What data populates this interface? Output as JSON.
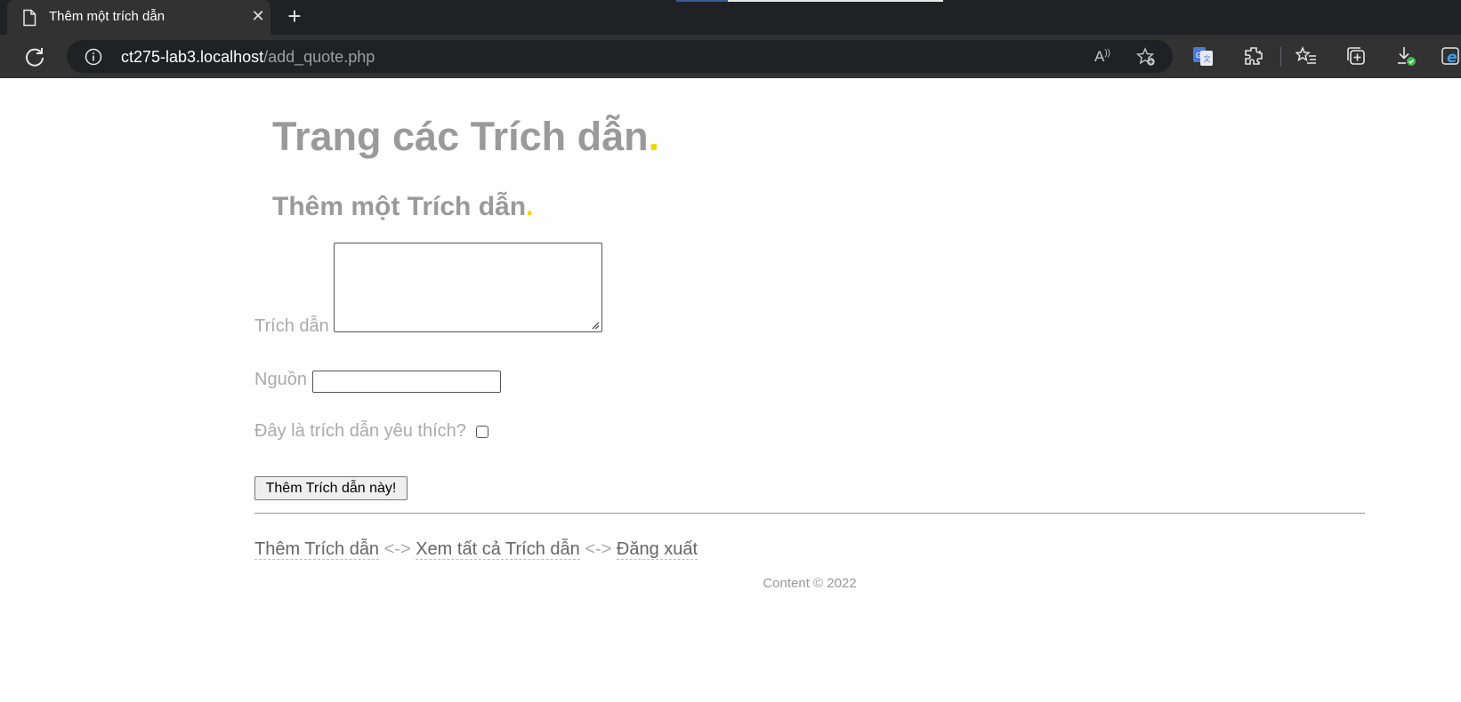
{
  "browser": {
    "tab_title": "Thêm một trích dẫn",
    "url_host": "ct275-lab3.localhost",
    "url_path": "/add_quote.php",
    "read_aloud_glyph": "Á"
  },
  "page": {
    "title": "Trang các Trích dẫn",
    "title_dot": ".",
    "subtitle": "Thêm một Trích dẫn",
    "subtitle_dot": "."
  },
  "form": {
    "quote_label": "Trích dẫn",
    "quote_value": "",
    "source_label": "Nguồn",
    "source_value": "",
    "favorite_label": "Đây là trích dẫn yêu thích?",
    "favorite_checked": false,
    "submit_label": "Thêm Trích dẫn này!"
  },
  "footer_nav": {
    "links": [
      "Thêm Trích dẫn",
      "Xem tất cả Trích dẫn",
      "Đăng xuất"
    ],
    "separator": "<->"
  },
  "copyright": "Content © 2022",
  "colors": {
    "heading": "#9a9a9a",
    "accent_dot": "#f2d600",
    "label": "#aaaaaa",
    "link": "#666666"
  }
}
